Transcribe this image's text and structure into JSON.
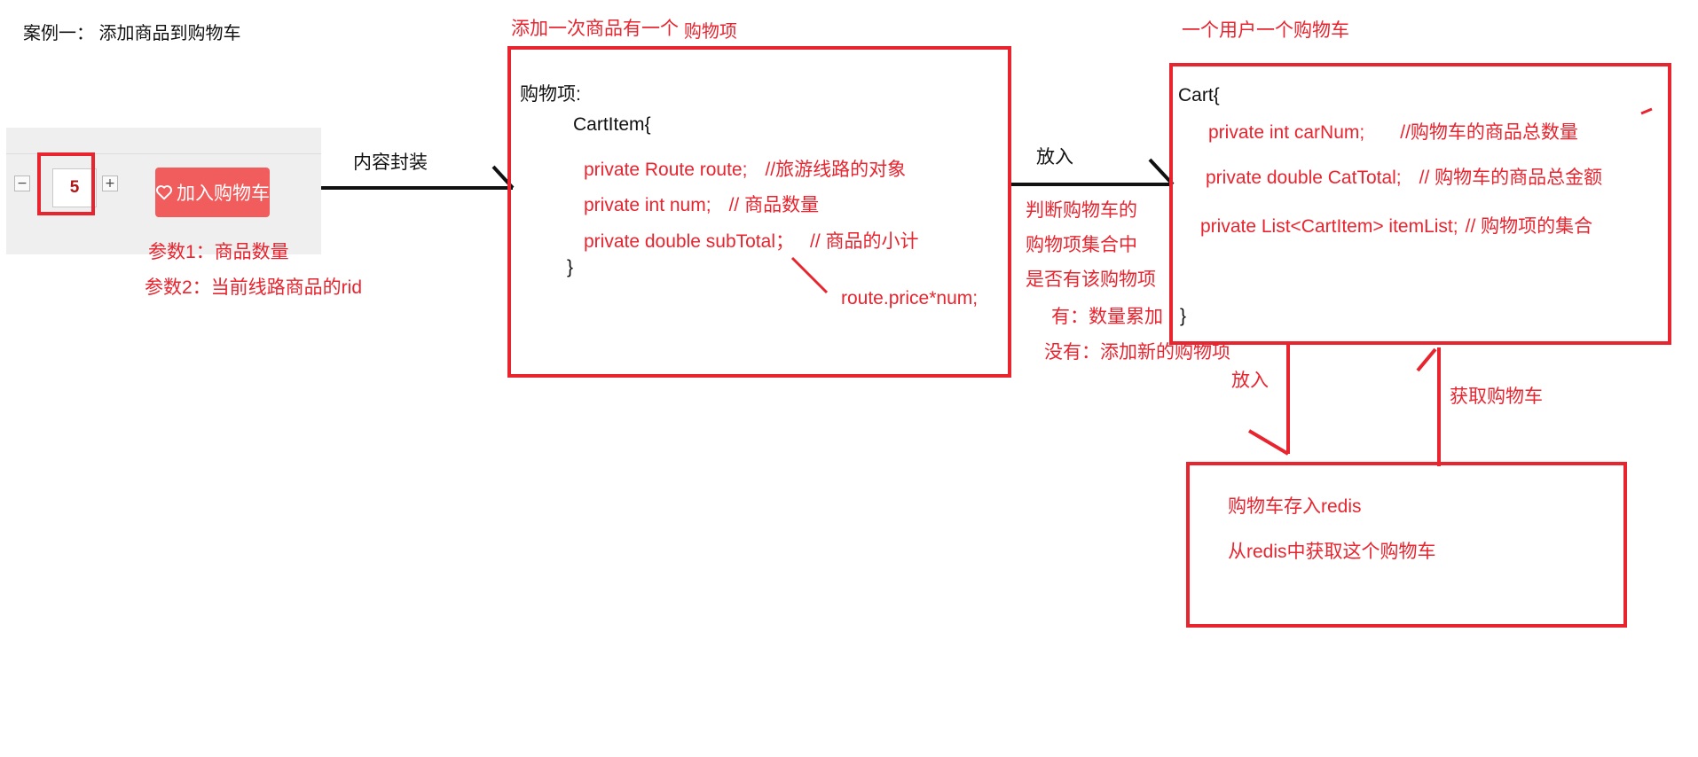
{
  "title": "案例一： 添加商品到购物车",
  "widget": {
    "minus": "−",
    "quantity": "5",
    "plus": "+",
    "add_to_cart": "加入购物车"
  },
  "params": {
    "p1": "参数1：商品数量",
    "p2": "参数2：当前线路商品的rid"
  },
  "arrow_labels": {
    "encapsulate": "内容封装",
    "put_in": "放入",
    "put_in_redis": "放入",
    "get_cart": "获取购物车"
  },
  "cartitem_box": {
    "header_prefix": "添加一次商品有一个 ",
    "header_suffix": "购物项",
    "label": "购物项:",
    "class_open": "CartItem{",
    "f1_code": "private Route   route;",
    "f1_comment": "//旅游线路的对象",
    "f2_code": "private int num;",
    "f2_comment": "// 商品数量",
    "f3_code": "private double subTotal；",
    "f3_comment": "// 商品的小计",
    "close": "}",
    "formula": "route.price*num;"
  },
  "judge": {
    "l1": "判断购物车的",
    "l2": "购物项集合中",
    "l3": "是否有该购物项",
    "l4": "有：数量累加",
    "l5": "没有：添加新的购物项"
  },
  "cart_box": {
    "header": "一个用户一个购物车",
    "class_open": "Cart{",
    "f1_code": "private int  carNum;",
    "f1_comment": "//购物车的商品总数量",
    "f2_code": "private double CatTotal;",
    "f2_comment": "// 购物车的商品总金额",
    "f3_code": "private List<CartItem> itemList;",
    "f3_comment": "// 购物项的集合",
    "close": "}"
  },
  "redis_box": {
    "l1": "购物车存入redis",
    "l2": "从redis中获取这个购物车"
  },
  "colors": {
    "annotation_red": "#e8242f",
    "button_red": "#f15c5c",
    "text_black": "#111111"
  }
}
